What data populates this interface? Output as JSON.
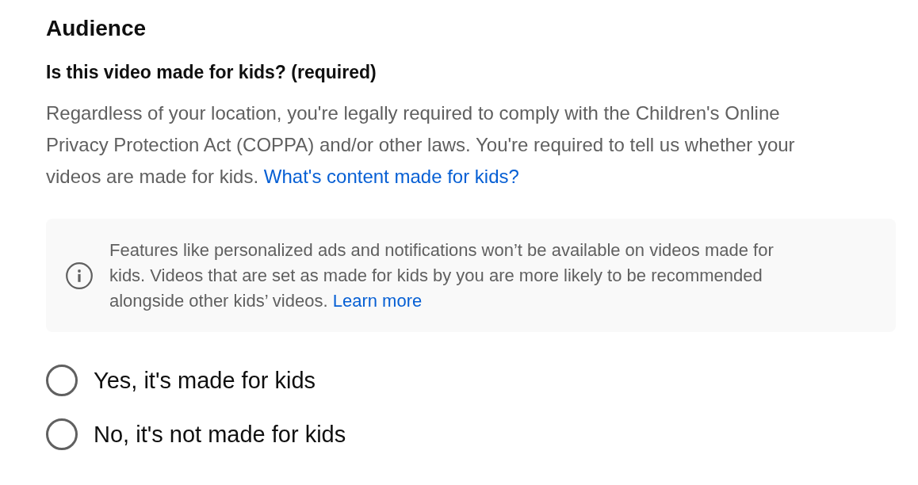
{
  "section": {
    "title": "Audience"
  },
  "question": {
    "title": "Is this video made for kids? (required)",
    "description": "Regardless of your location, you're legally required to comply with the Children's Online Privacy Protection Act (COPPA) and/or other laws. You're required to tell us whether your videos are made for kids.",
    "link": "What's content made for kids?"
  },
  "notice": {
    "text": "Features like personalized ads and notifications won’t be available on videos made for kids. Videos that are set as made for kids by you are more likely to be recommended alongside other kids’ videos.",
    "link": "Learn more"
  },
  "options": [
    {
      "label": "Yes, it's made for kids",
      "selected": false
    },
    {
      "label": "No, it's not made for kids",
      "selected": false
    }
  ]
}
